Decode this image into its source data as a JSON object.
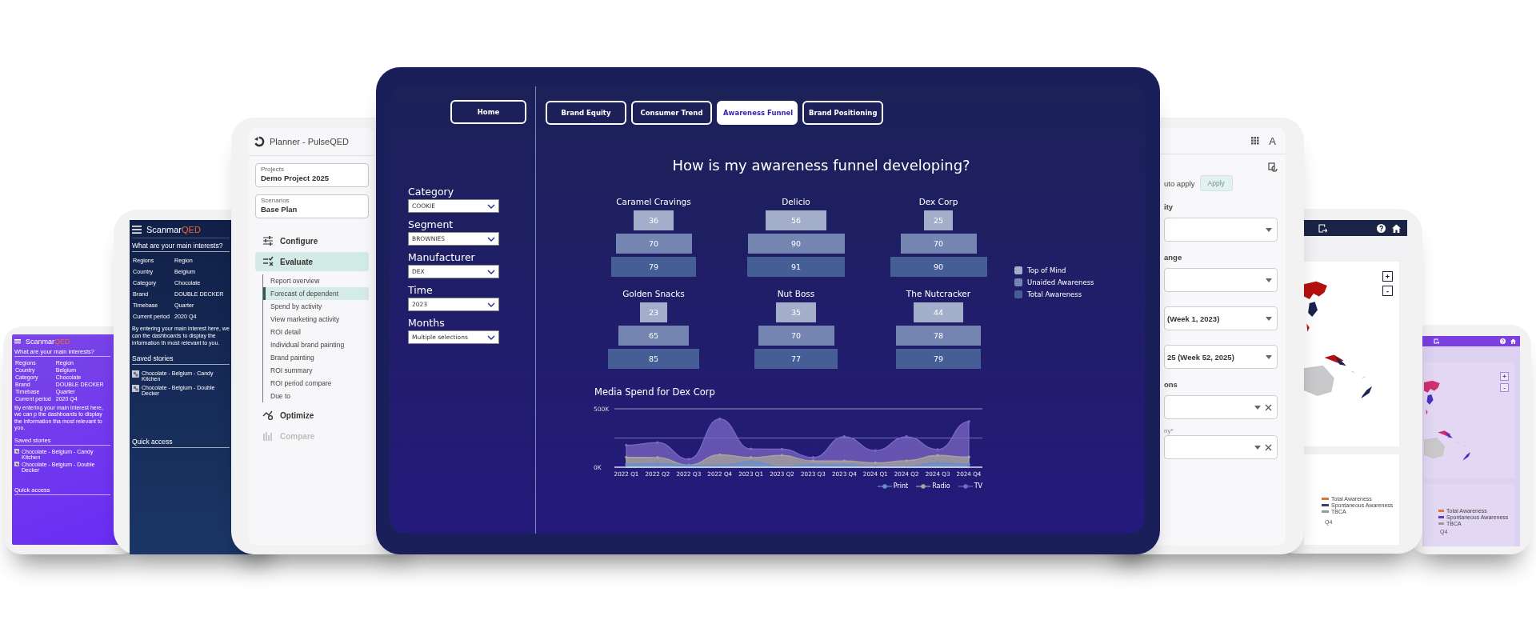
{
  "story_screen_small": {
    "logo": {
      "name": "Scanmar",
      "accent": "QED"
    },
    "heading": "What are your main interests?",
    "fields": [
      {
        "label": "Regions",
        "value": "Region"
      },
      {
        "label": "Country",
        "value": "Belgium"
      },
      {
        "label": "Category",
        "value": "Chocolate"
      },
      {
        "label": "Brand",
        "value": "DOUBLE DECKER"
      },
      {
        "label": "Timebase",
        "value": "Quarter"
      },
      {
        "label": "Current period",
        "value": "2020 Q4"
      }
    ],
    "note": "By entering your main interest here, we can p the dashboards to display the information tha most relevant to you.",
    "saved_heading": "Saved stories",
    "stories": [
      "Chocolate - Belgium - Candy Kitchen",
      "Chocolate - Belgium - Double Decker"
    ],
    "quick_access_heading": "Quick access"
  },
  "story_screen": {
    "logo": {
      "name": "Scanmar",
      "accent": "QED"
    },
    "heading": "What are your main interests?",
    "fields": [
      {
        "label": "Regions",
        "value": "Region"
      },
      {
        "label": "Country",
        "value": "Belgium"
      },
      {
        "label": "Category",
        "value": "Chocolate"
      },
      {
        "label": "Brand",
        "value": "DOUBLE DECKER"
      },
      {
        "label": "Timebase",
        "value": "Quarter"
      },
      {
        "label": "Current period",
        "value": "2020 Q4"
      }
    ],
    "note": "By entering your main interest here, we can the dashboards to display the information th most relevant to you.",
    "saved_heading": "Saved stories",
    "stories": [
      "Chocolate - Belgium - Candy Kitchen",
      "Chocolate - Belgium - Double Decker"
    ],
    "quick_access_heading": "Quick access"
  },
  "planner": {
    "title": "Planner - PulseQED",
    "fields": [
      {
        "label": "Projects",
        "value": "Demo Project 2025"
      },
      {
        "label": "Scenarios",
        "value": "Base Plan"
      }
    ],
    "nav": [
      {
        "kind": "configure",
        "label": "Configure",
        "selected": false,
        "disabled": false
      },
      {
        "kind": "evaluate",
        "label": "Evaluate",
        "selected": true,
        "disabled": false,
        "children": [
          {
            "label": "Report overview",
            "selected": false
          },
          {
            "label": "Forecast of dependent",
            "selected": true
          },
          {
            "label": "Spend by activity",
            "selected": false
          },
          {
            "label": "View marketing activity",
            "selected": false
          },
          {
            "label": "ROI detail",
            "selected": false
          },
          {
            "label": "Individual brand painting",
            "selected": false
          },
          {
            "label": "Brand painting",
            "selected": false
          },
          {
            "label": "ROI summary",
            "selected": false
          },
          {
            "label": "ROI period compare",
            "selected": false
          },
          {
            "label": "Due to",
            "selected": false
          }
        ]
      },
      {
        "kind": "optimize",
        "label": "Optimize",
        "selected": false,
        "disabled": false
      },
      {
        "kind": "compare",
        "label": "Compare",
        "selected": false,
        "disabled": true
      }
    ]
  },
  "dashboard": {
    "home": "Home",
    "tabs": [
      {
        "label": "Brand Equity",
        "selected": false
      },
      {
        "label": "Consumer Trend",
        "selected": false
      },
      {
        "label": "Awareness Funnel",
        "selected": true
      },
      {
        "label": "Brand Positioning",
        "selected": false
      }
    ],
    "filters": [
      {
        "label": "Category",
        "value": "COOKIE"
      },
      {
        "label": "Segment",
        "value": "BROWNIES"
      },
      {
        "label": "Manufacturer",
        "value": "DEX"
      },
      {
        "label": "Time",
        "value": "2023"
      },
      {
        "label": "Months",
        "value": "Multiple selections"
      }
    ],
    "title": "How is my awareness funnel developing?",
    "funnels": [
      {
        "name": "Caramel Cravings",
        "values": [
          "36",
          "70",
          "79"
        ]
      },
      {
        "name": "Delicio",
        "values": [
          "56",
          "90",
          "91"
        ]
      },
      {
        "name": "Dex Corp",
        "values": [
          "25",
          "70",
          "90"
        ]
      },
      {
        "name": "Golden Snacks",
        "values": [
          "23",
          "65",
          "85"
        ]
      },
      {
        "name": "Nut Boss",
        "values": [
          "35",
          "70",
          "77"
        ]
      },
      {
        "name": "The Nutcracker",
        "values": [
          "44",
          "78",
          "79"
        ]
      }
    ],
    "legend": [
      {
        "label": "Top of Mind",
        "color": "#a3aecb"
      },
      {
        "label": "Unaided Awareness",
        "color": "#7385b0"
      },
      {
        "label": "Total Awareness",
        "color": "#455f96"
      }
    ],
    "chart": {
      "chart_data": {
        "type": "area",
        "title": "Media Spend for Dex Corp",
        "categories": [
          "2022 Q1",
          "2022 Q2",
          "2022 Q3",
          "2022 Q4",
          "2023 Q1",
          "2023 Q2",
          "2023 Q3",
          "2023 Q4",
          "2024 Q1",
          "2024 Q2",
          "2024 Q3",
          "2024 Q4"
        ],
        "series": [
          {
            "name": "Print",
            "color": "#6a8fc8",
            "values": [
              23000,
              32000,
              16000,
              14000,
              50000,
              5000,
              23000,
              23000,
              5000,
              5000,
              39000,
              23000
            ]
          },
          {
            "name": "Radio",
            "color": "#a8a69c",
            "values": [
              85000,
              83000,
              18000,
              106000,
              83000,
              101000,
              53000,
              53000,
              37000,
              55000,
              101000,
              87000
            ]
          },
          {
            "name": "TV",
            "color": "#7b68c4",
            "values": [
              188000,
              211000,
              69000,
              413000,
              156000,
              154000,
              83000,
              261000,
              142000,
              261000,
              151000,
              390000
            ]
          }
        ],
        "ylim": [
          0,
          500000
        ],
        "yticks": [
          {
            "value": 0,
            "label": "0K"
          },
          {
            "value": 500000,
            "label": "500K"
          }
        ],
        "ref_lines": [
          {
            "axis": "y",
            "value": 250000
          }
        ],
        "legend": true
      }
    }
  },
  "settings_panel": {
    "avatar": "A",
    "auto_apply": "uto apply",
    "apply": {
      "label": "Apply",
      "disabled": true
    },
    "items": [
      {
        "kind": "heading",
        "text": "ity"
      },
      {
        "kind": "select"
      },
      {
        "kind": "heading",
        "text": "ange"
      },
      {
        "kind": "select"
      },
      {
        "kind": "select",
        "value": "(Week 1, 2023)"
      },
      {
        "kind": "select",
        "value": "25 (Week 52, 2025)"
      },
      {
        "kind": "heading",
        "text": "ons"
      },
      {
        "kind": "clearable"
      },
      {
        "kind": "clearable",
        "label": "ny*"
      }
    ]
  },
  "map_screen": {
    "zoom_in": "+",
    "zoom_out": "-",
    "legend": [
      {
        "label": "Total Awareness",
        "color": "#e2703a"
      },
      {
        "label": "Spontaneous Awareness",
        "color": "#3a4068"
      },
      {
        "label": "TBCA",
        "color": "#9a9a9a"
      }
    ],
    "axis_label": "Q4"
  },
  "map_screen_small": {
    "zoom_in": "+",
    "zoom_out": "-",
    "legend": [
      {
        "label": "Total Awareness",
        "color": "#e2703a"
      },
      {
        "label": "Spontaneous Awareness",
        "color": "#5a3fb0"
      },
      {
        "label": "TBCA",
        "color": "#9a9a9a"
      }
    ],
    "axis_label": "Q4"
  }
}
